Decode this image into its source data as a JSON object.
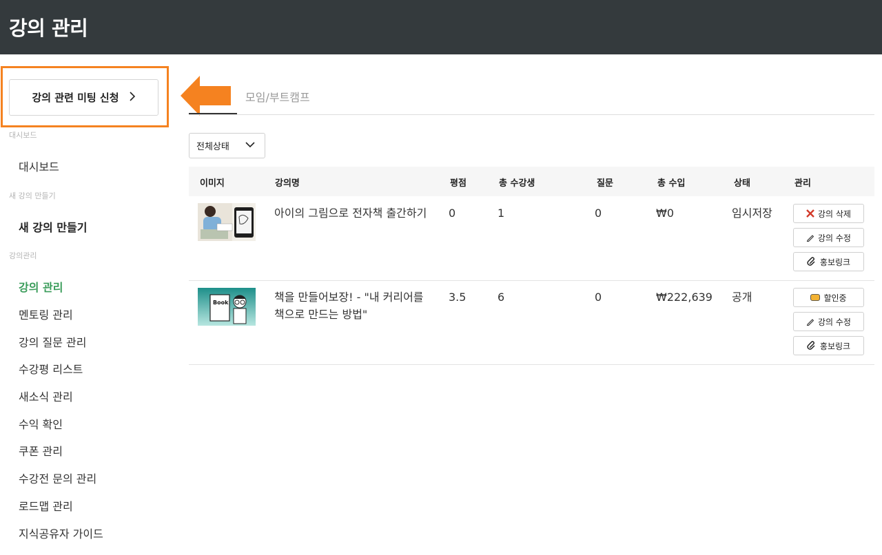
{
  "header": {
    "title": "강의 관리"
  },
  "sidebar": {
    "meeting_button": "강의 관련 미팅 신청",
    "sections": [
      {
        "label": "대시보드",
        "items": [
          "대시보드"
        ]
      },
      {
        "label": "새 강의 만들기",
        "items": [
          "새 강의 만들기"
        ]
      },
      {
        "label": "강의관리",
        "items": [
          "강의 관리",
          "멘토링 관리",
          "강의 질문 관리",
          "수강평 리스트",
          "새소식 관리",
          "수익 확인",
          "쿠폰 관리",
          "수강전 문의 관리",
          "로드맵 관리",
          "지식공유자 가이드"
        ]
      }
    ]
  },
  "tabs": {
    "second": "모임/부트캠프"
  },
  "filter": {
    "selected": "전체상태"
  },
  "table": {
    "headers": [
      "이미지",
      "강의명",
      "평점",
      "총 수강생",
      "질문",
      "총 수입",
      "상태",
      "관리"
    ],
    "rows": [
      {
        "name": "아이의 그림으로 전자책 출간하기",
        "rating": "0",
        "students": "1",
        "questions": "0",
        "revenue": "₩0",
        "status": "임시저장",
        "actions": [
          "강의 삭제",
          "강의 수정",
          "홍보링크"
        ]
      },
      {
        "name": "책을 만들어보장! - \"내 커리어를 책으로 만드는 방법\"",
        "rating": "3.5",
        "students": "6",
        "questions": "0",
        "revenue": "₩222,639",
        "status": "공개",
        "thumb_text": "Book",
        "actions": [
          "할인중",
          "강의 수정",
          "홍보링크"
        ]
      }
    ]
  },
  "colors": {
    "header_bg": "#343a3d",
    "accent": "#f58220",
    "active": "#3a9c5a"
  }
}
